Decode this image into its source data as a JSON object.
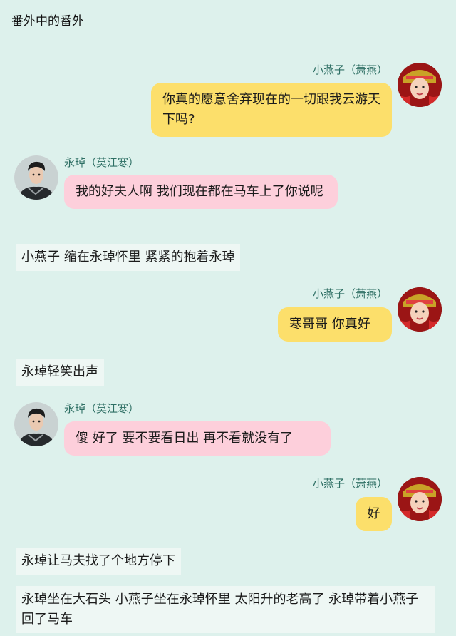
{
  "header": {
    "title": "番外中的番外"
  },
  "speakers": {
    "xiaoyanzi": "小燕子（萧燕）",
    "yongqi": "永琸（莫江寒）"
  },
  "messages": {
    "m1": "你真的愿意舍弃现在的一切跟我云游天下吗?",
    "m2": "我的好夫人啊 我们现在都在马车上了你说呢",
    "m3": "寒哥哥 你真好",
    "m4": "傻 好了 要不要看日出 再不看就没有了",
    "m5": "好"
  },
  "narration": {
    "n1": "小燕子 缩在永琸怀里 紧紧的抱着永琸",
    "n2": "永琸轻笑出声",
    "n3": "永琸让马夫找了个地方停下",
    "n4": "永琸坐在大石头 小燕子坐在永琸怀里 太阳升的老高了 永琸带着小燕子回了马车"
  },
  "colors": {
    "background": "#ddf1ec",
    "name_text": "#2e6f64",
    "bubble_yellow": "#fcdf6b",
    "bubble_pink": "#fdcfdb",
    "narration_bg": "#eef7f4"
  },
  "icons": {
    "xiaoyanzi_avatar": "bride-avatar-icon",
    "yongqi_avatar": "man-avatar-icon"
  }
}
